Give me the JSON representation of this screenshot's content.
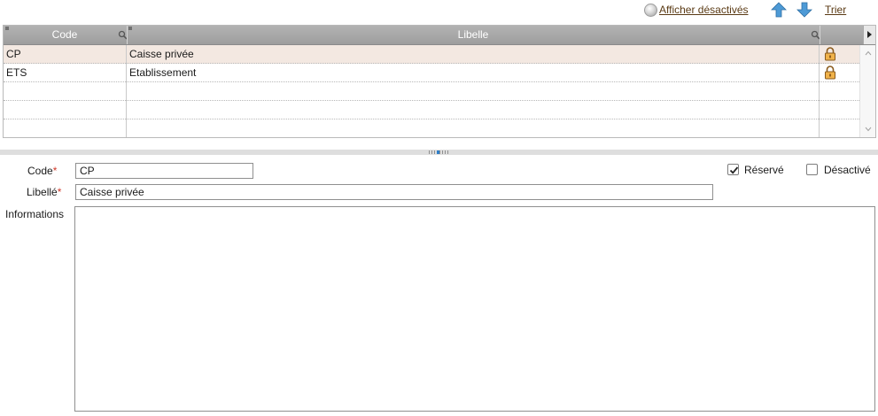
{
  "toolbar": {
    "show_disabled_label": "Afficher désactivés",
    "sort_label": "Trier"
  },
  "grid": {
    "columns": [
      {
        "label": "Code"
      },
      {
        "label": "Libelle"
      }
    ],
    "rows": [
      {
        "code": "CP",
        "libelle": "Caisse privée",
        "locked": true,
        "selected": true
      },
      {
        "code": "ETS",
        "libelle": "Etablissement",
        "locked": true,
        "selected": false
      }
    ]
  },
  "form": {
    "code_label": "Code",
    "code_value": "CP",
    "libelle_label": "Libellé",
    "libelle_value": "Caisse privée",
    "informations_label": "Informations",
    "informations_value": "",
    "required_mark": "*",
    "reserved_label": "Réservé",
    "reserved_checked": true,
    "disabled_label": "Désactivé",
    "disabled_checked": false
  },
  "colors": {
    "link": "#5a3a14",
    "header": "#a8a8a8",
    "selected_row": "#f3e8e1",
    "required": "#d03a2b",
    "arrow": "#3a8cc9"
  },
  "icons": [
    "eye-icon",
    "arrow-up-icon",
    "arrow-down-icon",
    "magnifier-icon",
    "lock-icon",
    "checkmark-icon"
  ]
}
